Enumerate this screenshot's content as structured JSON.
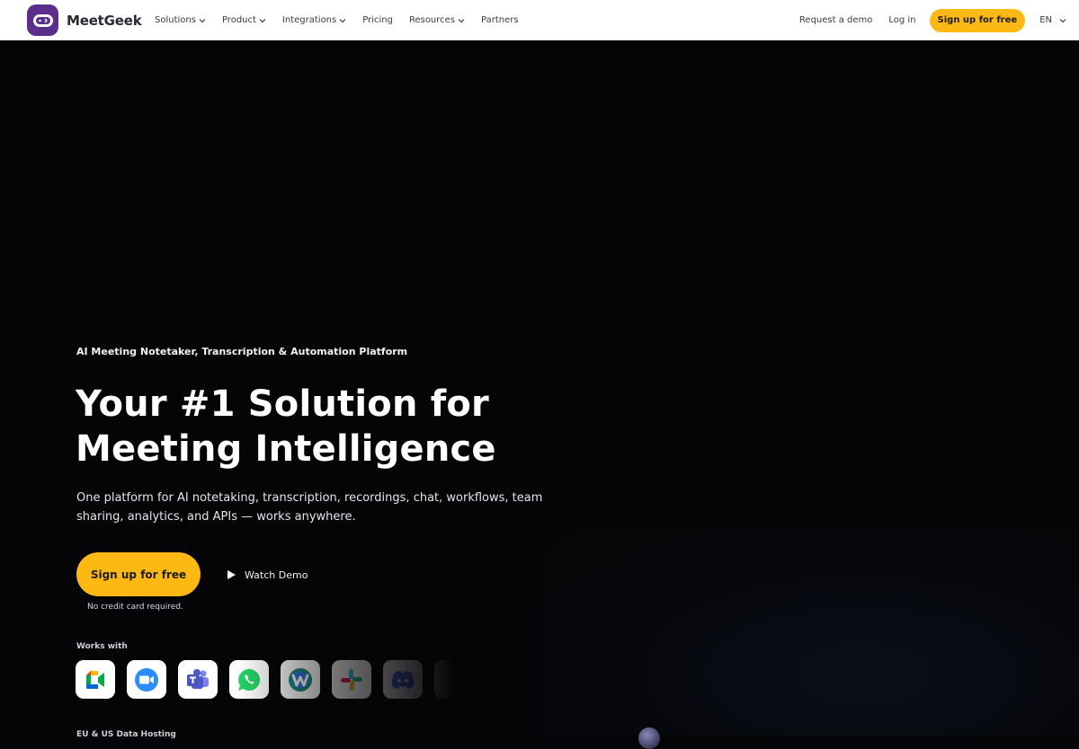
{
  "nav": {
    "brand": "MeetGeek",
    "menu": [
      {
        "label": "Solutions",
        "has_dropdown": true
      },
      {
        "label": "Product",
        "has_dropdown": true
      },
      {
        "label": "Integrations",
        "has_dropdown": true
      },
      {
        "label": "Pricing",
        "has_dropdown": false
      },
      {
        "label": "Resources",
        "has_dropdown": true
      },
      {
        "label": "Partners",
        "has_dropdown": false
      }
    ],
    "request_demo": "Request a demo",
    "login": "Log in",
    "signup": "Sign up for free",
    "language": "EN"
  },
  "hero": {
    "eyebrow": "AI Meeting Notetaker, Transcription & Automation Platform",
    "headline_line1": "Your #1 Solution for",
    "headline_line2": "Meeting Intelligence",
    "subtitle": "One platform for AI notetaking, transcription, recordings, chat, workflows, team sharing, analytics, and APIs — works anywhere.",
    "cta_primary": "Sign up for free",
    "cta_secondary": "Watch Demo",
    "note": "No credit card required.",
    "works_with": "Works with",
    "integrations": [
      "google-meet-icon",
      "zoom-icon",
      "microsoft-teams-icon",
      "whatsapp-icon",
      "webex-icon",
      "slack-icon",
      "discord-icon",
      "integration-icon"
    ],
    "hosting": "EU & US Data Hosting"
  },
  "colors": {
    "accent": "#fdb813",
    "brand": "#5a2e8a",
    "background": "#050507"
  }
}
